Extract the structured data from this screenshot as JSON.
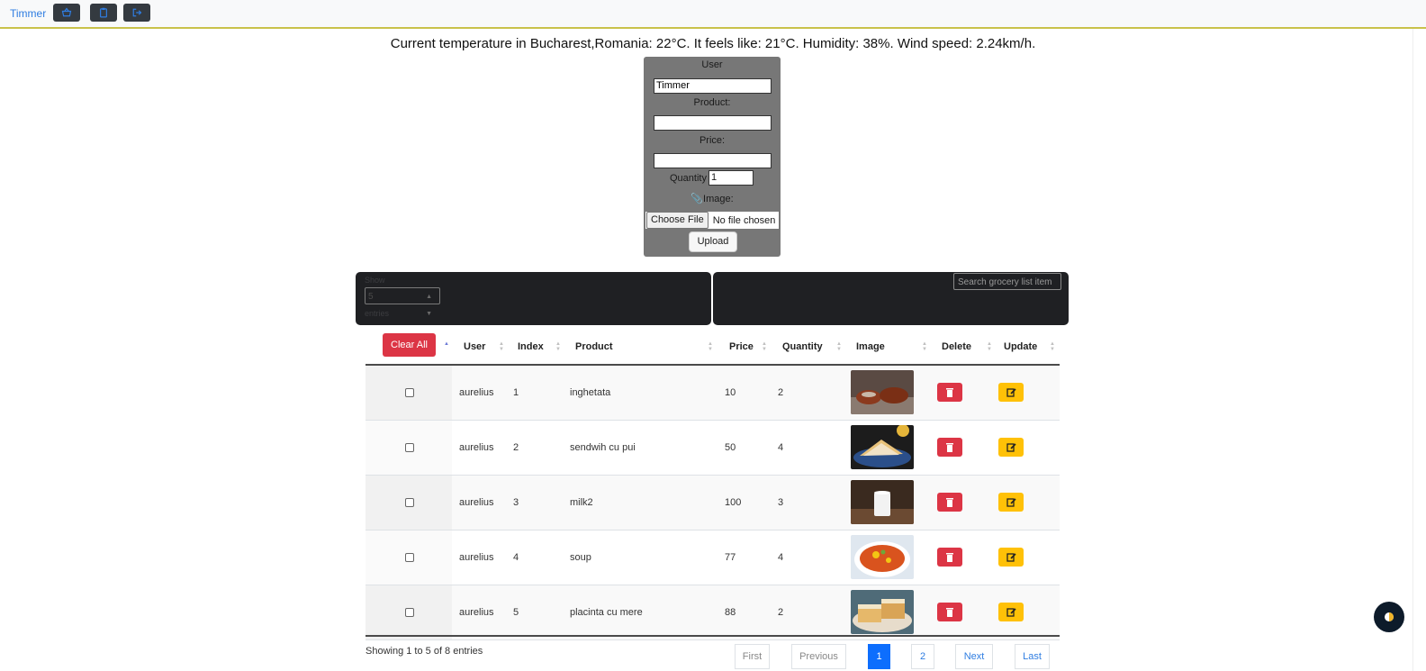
{
  "navbar": {
    "brand": "Timmer",
    "buttons": [
      {
        "icon": "basket-icon"
      },
      {
        "icon": "clipboard-icon"
      },
      {
        "icon": "logout-icon"
      }
    ]
  },
  "weather_text": "Current temperature in Bucharest,Romania: 22°C. It feels like: 21°C. Humidity: 38%. Wind speed: 2.24km/h.",
  "form": {
    "user_label": "User",
    "user_value": "Timmer",
    "product_label": "Product:",
    "product_value": "",
    "price_label": "Price:",
    "price_value": "",
    "quantity_label": "Quantity",
    "quantity_value": "1",
    "image_label": "Image:",
    "choose_file": "Choose File",
    "no_file": "No file chosen",
    "upload": "Upload"
  },
  "table_controls": {
    "show_label": "Show",
    "length_value": "5",
    "entries_label": "entries",
    "search_placeholder": "Search grocery list item"
  },
  "table": {
    "clear_all": "Clear All",
    "headers": [
      "User",
      "Index",
      "Product",
      "Price",
      "Quantity",
      "Image",
      "Delete",
      "Update"
    ],
    "rows": [
      {
        "user": "aurelius",
        "index": "1",
        "product": "inghetata",
        "price": "10",
        "quantity": "2"
      },
      {
        "user": "aurelius",
        "index": "2",
        "product": "sendwih cu pui",
        "price": "50",
        "quantity": "4"
      },
      {
        "user": "aurelius",
        "index": "3",
        "product": "milk2",
        "price": "100",
        "quantity": "3"
      },
      {
        "user": "aurelius",
        "index": "4",
        "product": "soup",
        "price": "77",
        "quantity": "4"
      },
      {
        "user": "aurelius",
        "index": "5",
        "product": "placinta cu mere",
        "price": "88",
        "quantity": "2"
      }
    ]
  },
  "footer": {
    "info": "Showing 1 to 5 of 8 entries",
    "first": "First",
    "previous": "Previous",
    "page1": "1",
    "page2": "2",
    "next": "Next",
    "last": "Last"
  },
  "colors": {
    "danger": "#dc3545",
    "warning": "#ffc107",
    "primary": "#0d6efd",
    "form_bg": "#777777",
    "controls_bg": "#1f2023"
  }
}
